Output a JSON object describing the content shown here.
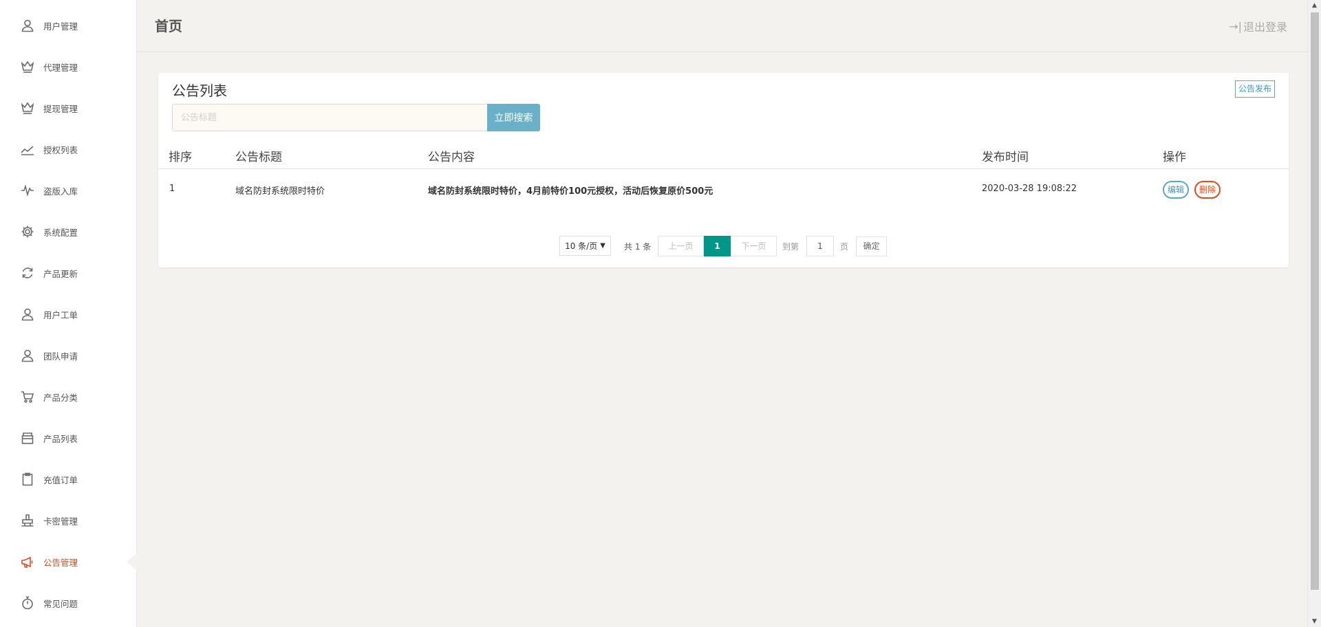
{
  "sidebar": {
    "items": [
      {
        "label": "用户管理",
        "icon": "user-icon"
      },
      {
        "label": "代理管理",
        "icon": "crown-icon"
      },
      {
        "label": "提现管理",
        "icon": "crown-icon"
      },
      {
        "label": "授权列表",
        "icon": "trend-icon"
      },
      {
        "label": "盗版入库",
        "icon": "pulse-icon"
      },
      {
        "label": "系统配置",
        "icon": "gear-icon"
      },
      {
        "label": "产品更新",
        "icon": "refresh-icon"
      },
      {
        "label": "用户工单",
        "icon": "user-icon"
      },
      {
        "label": "团队申请",
        "icon": "user-icon"
      },
      {
        "label": "产品分类",
        "icon": "cart-icon"
      },
      {
        "label": "产品列表",
        "icon": "box-icon"
      },
      {
        "label": "充值订单",
        "icon": "clipboard-icon"
      },
      {
        "label": "卡密管理",
        "icon": "stamp-icon"
      },
      {
        "label": "公告管理",
        "icon": "megaphone-icon",
        "active": true
      },
      {
        "label": "常见问题",
        "icon": "stopwatch-icon"
      }
    ],
    "active_color": "#e04b1c"
  },
  "header": {
    "title": "首页",
    "logout_arrow": "→|",
    "logout_label": "退出登录"
  },
  "card": {
    "title": "公告列表",
    "publish_button": "公告发布",
    "search": {
      "placeholder": "公告标题",
      "value": "",
      "button": "立即搜索"
    },
    "table": {
      "columns": [
        "排序",
        "公告标题",
        "公告内容",
        "发布时间",
        "操作"
      ],
      "rows": [
        {
          "order": "1",
          "title": "域名防封系统限时特价",
          "content": "域名防封系统限时特价，4月前特价100元授权，活动后恢复原价500元",
          "time": "2020-03-28 19:08:22",
          "edit": "编辑",
          "delete": "删除"
        }
      ]
    },
    "pagination": {
      "page_size": "10 条/页",
      "total": "共 1 条",
      "prev": "上一页",
      "current": "1",
      "next": "下一页",
      "goto_label": "到第",
      "goto_value": "1",
      "page_unit": "页",
      "confirm": "确定"
    }
  },
  "colors": {
    "accent_teal": "#009688",
    "search_button": "#6ab0c8",
    "link_blue": "#3d9ac0",
    "danger": "#e04b1c",
    "background": "#f3f2ef"
  }
}
